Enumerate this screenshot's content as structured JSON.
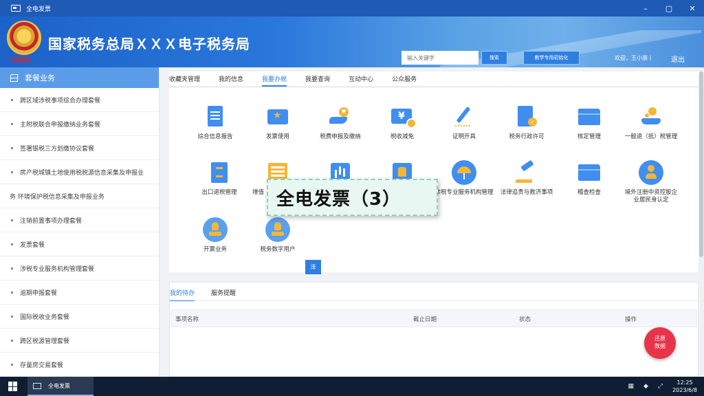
{
  "window": {
    "title": "全电发票",
    "controls": [
      "–",
      "▢",
      "✕"
    ]
  },
  "header": {
    "emblem_text": "中国税务",
    "site_title": "国家税务总局ＸＸＸ电子税务局",
    "search_placeholder": "输入关键字",
    "search_button": "搜索",
    "init_button": "教学专用初始化",
    "welcome": "欢迎，王小丽丨",
    "logout": "退出"
  },
  "sidebar": {
    "header": "套餐业务",
    "items": [
      {
        "label": "跨区域涉税事项综合办理套餐"
      },
      {
        "label": "主附税联合申报缴纳业务套餐"
      },
      {
        "label": "签署银税三方划缴协议套餐"
      },
      {
        "label": "房产税城镇土地使用税税源信息采集及申报业"
      },
      {
        "label": "务 环境保护税信息采集及申报业务"
      },
      {
        "label": "注销前置事项办理套餐"
      },
      {
        "label": "发票套餐"
      },
      {
        "label": "涉税专业服务机构管理套餐"
      },
      {
        "label": "逾期申报套餐"
      },
      {
        "label": "国际税收业务套餐"
      },
      {
        "label": "跨区税源管理套餐"
      },
      {
        "label": "存量房交易套餐"
      }
    ]
  },
  "nav_tabs": [
    {
      "label": "收藏夹管理",
      "active": false
    },
    {
      "label": "我的信息",
      "active": false
    },
    {
      "label": "我要办税",
      "active": true
    },
    {
      "label": "我要查询",
      "active": false
    },
    {
      "label": "互动中心",
      "active": false
    },
    {
      "label": "公众服务",
      "active": false
    }
  ],
  "tiles": [
    {
      "label": "综合信息报告",
      "icon": "document-icon"
    },
    {
      "label": "发票使用",
      "icon": "invoice-star-icon"
    },
    {
      "label": "税费申报及缴纳",
      "icon": "hand-heart-icon"
    },
    {
      "label": "税收减免",
      "icon": "yen-ticket-icon"
    },
    {
      "label": "证明开具",
      "icon": "pen-icon"
    },
    {
      "label": "税务行政许可",
      "icon": "document-check-icon"
    },
    {
      "label": "核定管理",
      "icon": "folder-icon"
    },
    {
      "label": "一般退（抵）税管理",
      "icon": "coin-hand-icon"
    },
    {
      "label": "出口退税管理",
      "icon": "cabinet-icon"
    },
    {
      "label": "增值",
      "icon": "list-icon"
    },
    {
      "label": "",
      "icon": "bar-chart-icon"
    },
    {
      "label": "",
      "icon": "thumb-icon"
    },
    {
      "label": "涉税专业服务机构管理",
      "icon": "umbrella-icon"
    },
    {
      "label": "法律追责与救济事项",
      "icon": "gavel-icon"
    },
    {
      "label": "稽查检查",
      "icon": "folder-icon"
    },
    {
      "label": "境外注册中资控股企业居民身认定",
      "icon": "person-icon"
    },
    {
      "label": "开票业务",
      "icon": "stamp-hand-icon"
    },
    {
      "label": "税务数字用户",
      "icon": "stamp-icon"
    }
  ],
  "overlay_caption": "全电发票（3）",
  "small_button": "泽",
  "todo": {
    "tabs": [
      {
        "label": "我的待办",
        "active": true
      },
      {
        "label": "服务提醒",
        "active": false
      }
    ],
    "columns": [
      "事项名称",
      "截止日期",
      "状态",
      "操作"
    ]
  },
  "fab": {
    "line1": "还原",
    "line2": "数据"
  },
  "taskbar": {
    "app_label": "全电发票",
    "time": "12:25",
    "date": "2023/6/8"
  },
  "colors": {
    "accent": "#2f7fe0",
    "banner": "#1c62c8",
    "fab": "#e8344a",
    "icon_blue": "#3f8ef0",
    "icon_gold": "#f4b63a"
  }
}
